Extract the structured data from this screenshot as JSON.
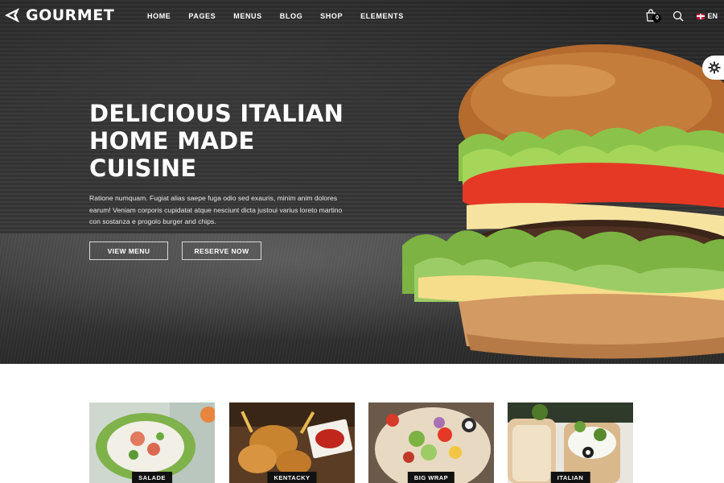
{
  "brand": {
    "name": "GOURMET"
  },
  "nav": {
    "items": [
      {
        "label": "HOME"
      },
      {
        "label": "PAGES"
      },
      {
        "label": "MENUS"
      },
      {
        "label": "BLOG"
      },
      {
        "label": "SHOP"
      },
      {
        "label": "ELEMENTS"
      }
    ],
    "cart_count": "0",
    "language": "EN"
  },
  "hero": {
    "title": "DELICIOUS ITALIAN HOME MADE CUISINE",
    "text": "Ratione numquam. Fugiat alias saepe fuga odio sed exauris, minim anim dolores earum! Veniam corporis cupidatat atque nesciunt dicta justoui varius loreto martino con sostanza e progolo burger and chips.",
    "button_menu": "VIEW MENU",
    "button_reserve": "RESERVE NOW"
  },
  "categories": [
    {
      "label": "SALADE"
    },
    {
      "label": "KENTACKY"
    },
    {
      "label": "BIG WRAP"
    },
    {
      "label": "ITALIAN"
    }
  ],
  "colors": {
    "hero_bg": "#2d2d2d",
    "text_light": "#ffffff",
    "label_bg": "#111111"
  },
  "icons": [
    "logo-icon",
    "cart-icon",
    "search-icon",
    "uk-flag-icon",
    "gear-icon"
  ]
}
